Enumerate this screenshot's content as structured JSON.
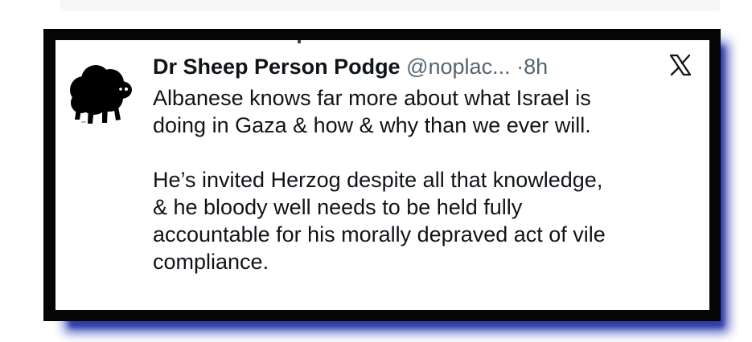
{
  "tweet": {
    "display_name": "Dr Sheep Person Podge",
    "handle": "@noplac...",
    "separator": "·",
    "time": "8h",
    "paragraphs": [
      {
        "lines": [
          "Albanese knows far more about what Israel is",
          "doing in Gaza & how & why than we ever will."
        ]
      },
      {
        "lines": [
          "He’s invited Herzog despite all that knowledge,",
          "& he bloody well needs to be held fully",
          "accountable for his morally depraved act of vile",
          "compliance."
        ]
      }
    ]
  },
  "icons": {
    "avatar": "black-sheep-avatar",
    "platform_logo": "x-logo-icon"
  },
  "colors": {
    "frame": "#050505",
    "shadow": "#3c4cc0",
    "text": "#0f1419",
    "muted": "#536471",
    "card": "#ffffff"
  }
}
